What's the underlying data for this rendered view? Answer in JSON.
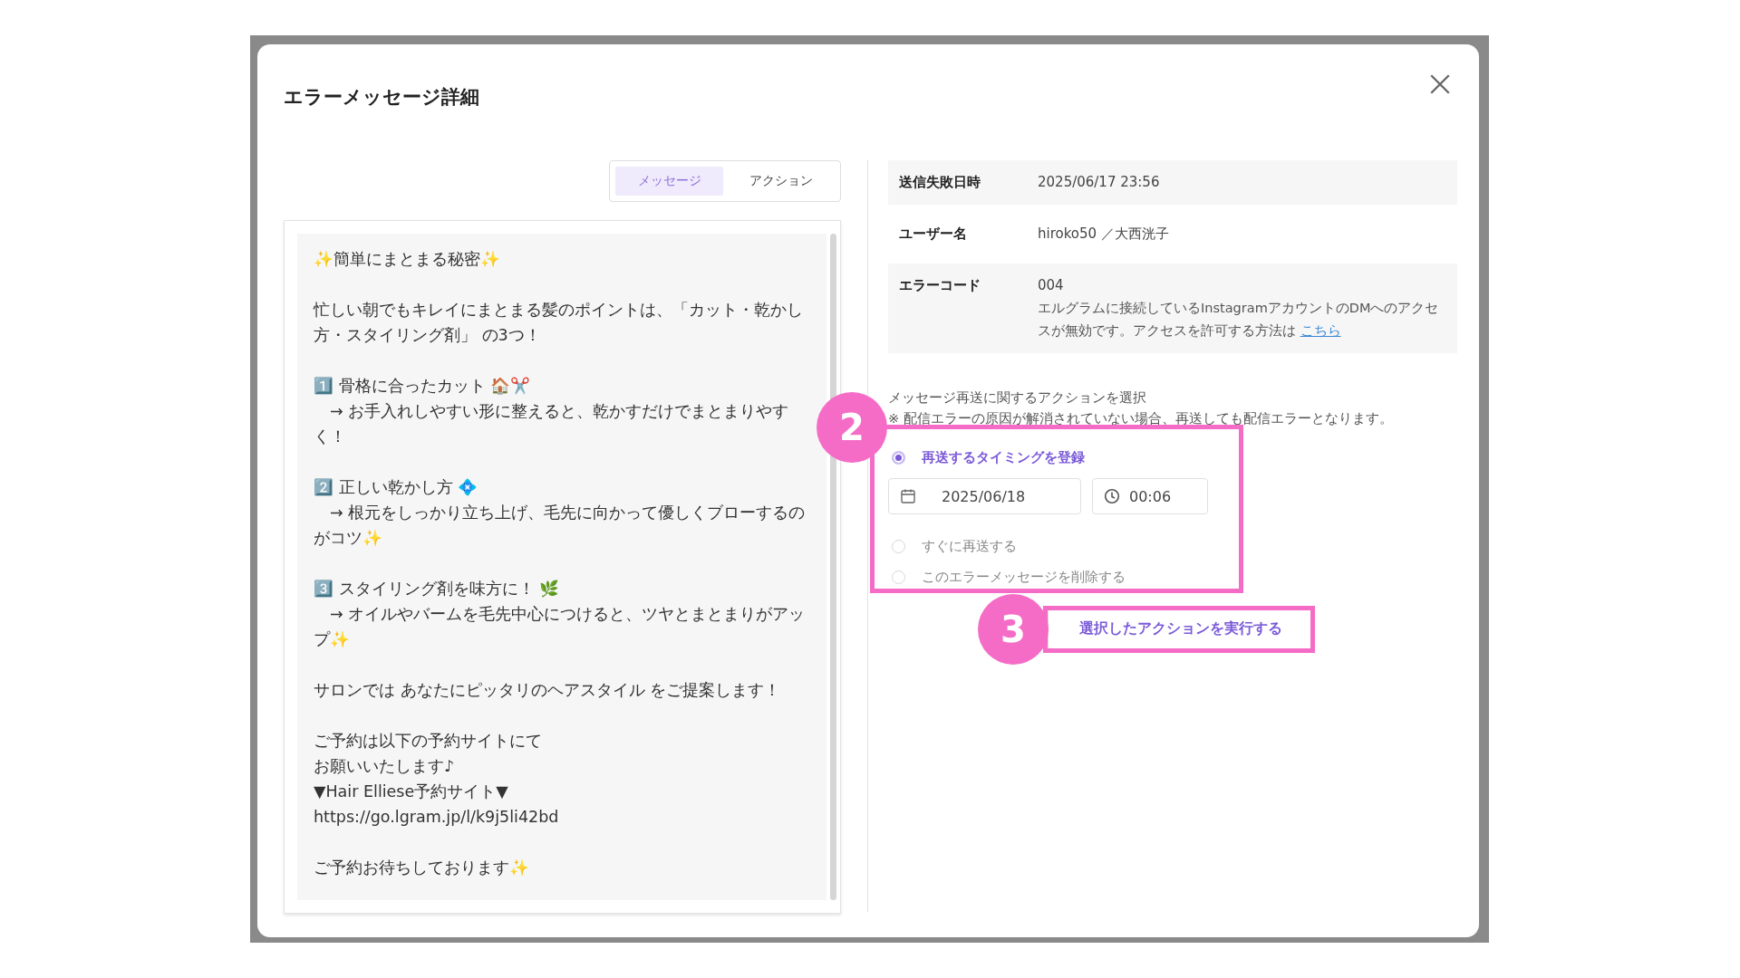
{
  "dialog": {
    "title": "エラーメッセージ詳細"
  },
  "tabs": [
    {
      "label": "メッセージ",
      "selected": true
    },
    {
      "label": "アクション",
      "selected": false
    }
  ],
  "message": {
    "paragraphs": [
      [
        "✨簡単にまとまる秘密✨"
      ],
      [
        "忙しい朝でもキレイにまとまる髪のポイントは、「カット・乾かし方・スタイリング剤」 の3つ！"
      ],
      [
        "1️⃣ 骨格に合ったカット 🏠✂️",
        "　→ お手入れしやすい形に整えると、乾かすだけでまとまりやすく！"
      ],
      [
        "2️⃣ 正しい乾かし方 💠",
        "　→ 根元をしっかり立ち上げ、毛先に向かって優しくブローするのがコツ✨"
      ],
      [
        "3️⃣ スタイリング剤を味方に！ 🌿",
        "　→ オイルやバームを毛先中心につけると、ツヤとまとまりがアップ✨"
      ],
      [
        "サロンでは あなたにピッタリのヘアスタイル をご提案します！"
      ],
      [
        "ご予約は以下の予約サイトにて",
        "お願いいたします♪",
        "▼Hair Elliese予約サイト▼",
        "https://go.lgram.jp/l/k9j5li42bd"
      ],
      [
        "ご予約お待ちしております✨"
      ]
    ]
  },
  "details": [
    {
      "label": "送信失敗日時",
      "value": "2025/06/17 23:56"
    },
    {
      "label": "ユーザー名",
      "value": "hiroko50 ／大西洸子"
    },
    {
      "label": "エラーコード",
      "value": "004",
      "description": "エルグラムに接続しているInstagramアカウントのDMへのアクセスが無効です。アクセスを許可する方法は",
      "link": "こちら"
    }
  ],
  "actions": {
    "heading": "メッセージ再送に関するアクションを選択",
    "note": "※ 配信エラーの原因が解消されていない場合、再送しても配信エラーとなります。",
    "options": [
      {
        "label": "再送するタイミングを登録",
        "selected": true
      },
      {
        "label": "すぐに再送する",
        "selected": false
      },
      {
        "label": "このエラーメッセージを削除する",
        "selected": false
      }
    ],
    "date": "2025/06/18",
    "time": "00:06",
    "button": "選択したアクションを実行する"
  },
  "callouts": [
    {
      "number": "2"
    },
    {
      "number": "3"
    }
  ]
}
